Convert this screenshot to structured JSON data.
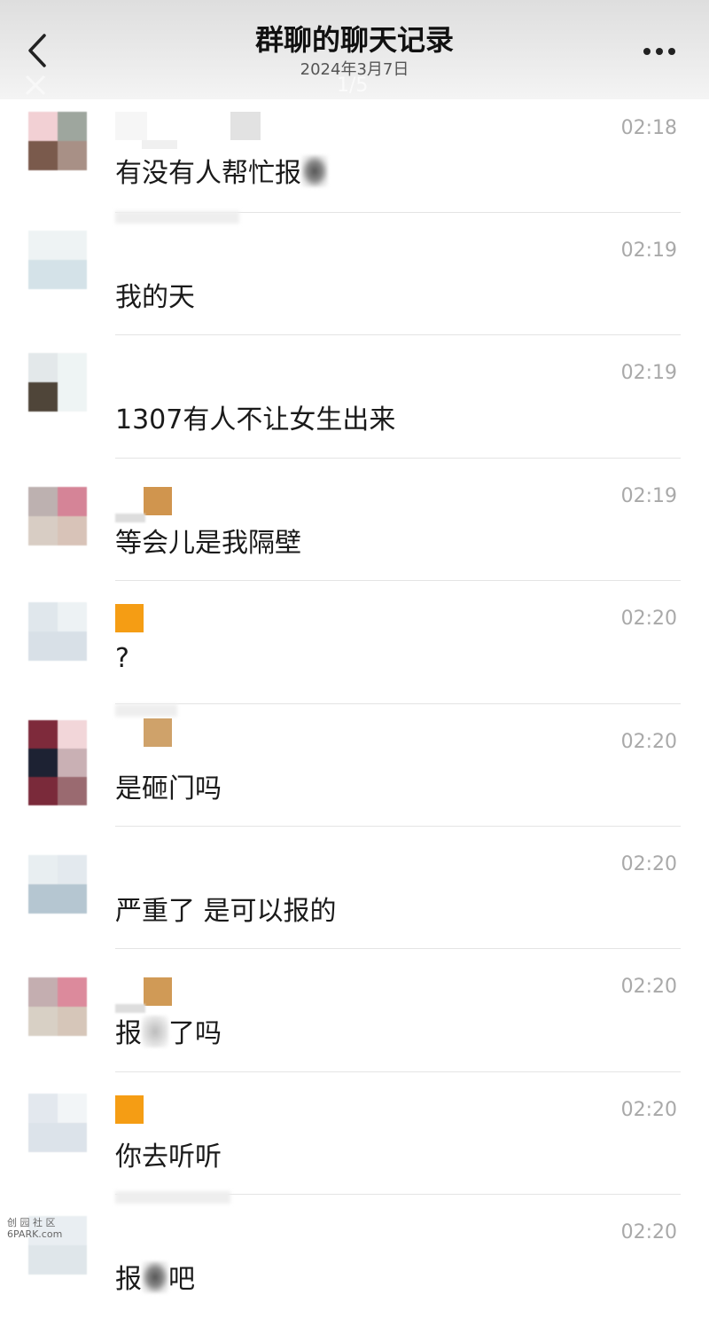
{
  "header": {
    "title": "群聊的聊天记录",
    "date": "2024年3月7日",
    "page_indicator": "1/5"
  },
  "messages": [
    {
      "time": "02:18",
      "text_before": "有没有人帮忙报",
      "text_after": "",
      "avatar_colors": [
        "#f2d0d4",
        "#9ea69e",
        "#7a5a4c",
        "#a89086"
      ]
    },
    {
      "time": "02:19",
      "text_before": "我的天",
      "text_after": "",
      "avatar_colors": [
        "#eef3f4",
        "#eef3f4",
        "#d4e2e8",
        "#d4e2e8"
      ]
    },
    {
      "time": "02:19",
      "text_before": "1307有人不让女生出来",
      "text_after": "",
      "avatar_colors": [
        "#e3e8ea",
        "#eef4f4",
        "#4f4539",
        "#eef4f4"
      ]
    },
    {
      "time": "02:19",
      "text_before": "等会儿是我隔壁",
      "text_after": "",
      "avatar_colors": [
        "#bdb1b0",
        "#d58497",
        "#d8cdc4",
        "#d8c3b8"
      ]
    },
    {
      "time": "02:20",
      "text_before": "?",
      "text_after": "",
      "avatar_colors": [
        "#e0e7ec",
        "#edf2f4",
        "#d8e0e7",
        "#d8e0e7"
      ]
    },
    {
      "time": "02:20",
      "text_before": "是砸门吗",
      "text_after": "",
      "avatar_colors": [
        "#7e2a3b",
        "#f2d6d9",
        "#1d2233",
        "#c9b0b4",
        "#7a2a3a",
        "#9a6a70"
      ]
    },
    {
      "time": "02:20",
      "text_before": "严重了 是可以报的",
      "text_after": "",
      "avatar_colors": [
        "#e8eef1",
        "#e3e9ee",
        "#b5c6d1",
        "#b5c6d1"
      ]
    },
    {
      "time": "02:20",
      "text_before": "报",
      "text_after": "了吗",
      "avatar_colors": [
        "#c4aeb0",
        "#dc8a9c",
        "#d8d0c5",
        "#d6c6b9"
      ]
    },
    {
      "time": "02:20",
      "text_before": "你去听听",
      "text_after": "",
      "avatar_colors": [
        "#e3e8ee",
        "#f2f5f7",
        "#dce3ea",
        "#dce3ea"
      ]
    },
    {
      "time": "02:20",
      "text_before": "报",
      "text_after": "吧",
      "avatar_colors": [
        "#e9eef2",
        "#e9eef2",
        "#dfe6ea",
        "#dfe6ea"
      ]
    }
  ],
  "watermark": {
    "line1": "创 园 社 区",
    "line2": "6PARK.com"
  }
}
